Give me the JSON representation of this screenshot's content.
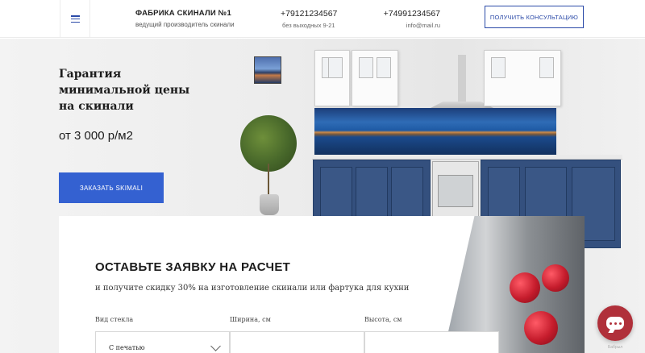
{
  "header": {
    "brand_title": "ФАБРИКА СКИНАЛИ №1",
    "brand_subtitle": "ведущий производитель скинали",
    "phone1": "+79121234567",
    "phone1_note": "без выходных 9-21",
    "phone2": "+74991234567",
    "email": "info@mail.ru",
    "consult_button": "ПОЛУЧИТЬ КОНСУЛЬТАЦИЮ"
  },
  "hero": {
    "title_lines": [
      "Гарантия",
      "минимальной цены",
      "на скинали"
    ],
    "price": "от 3 000 р/м2",
    "order_button": "ЗАКАЗАТЬ SKIMALI"
  },
  "form": {
    "title": "ОСТАВЬТЕ ЗАЯВКУ НА РАСЧЕТ",
    "subtitle": "и получите скидку 30% на изготовление скинали или фартука для кухни",
    "glass_type_label": "Вид стекла",
    "glass_type_value": "С печатью",
    "width_label": "Ширина, см",
    "height_label": "Высота, см"
  },
  "chat": {
    "caption": "Бабрыл"
  },
  "colors": {
    "accent": "#3461d1",
    "header_accent": "#2b4aa8",
    "chat": "#b0303a",
    "cabinet_blue": "#34507e"
  },
  "icons": {
    "menu": "hamburger-menu-icon",
    "select": "chevron-down-icon",
    "chat": "chat-bubble-icon"
  }
}
